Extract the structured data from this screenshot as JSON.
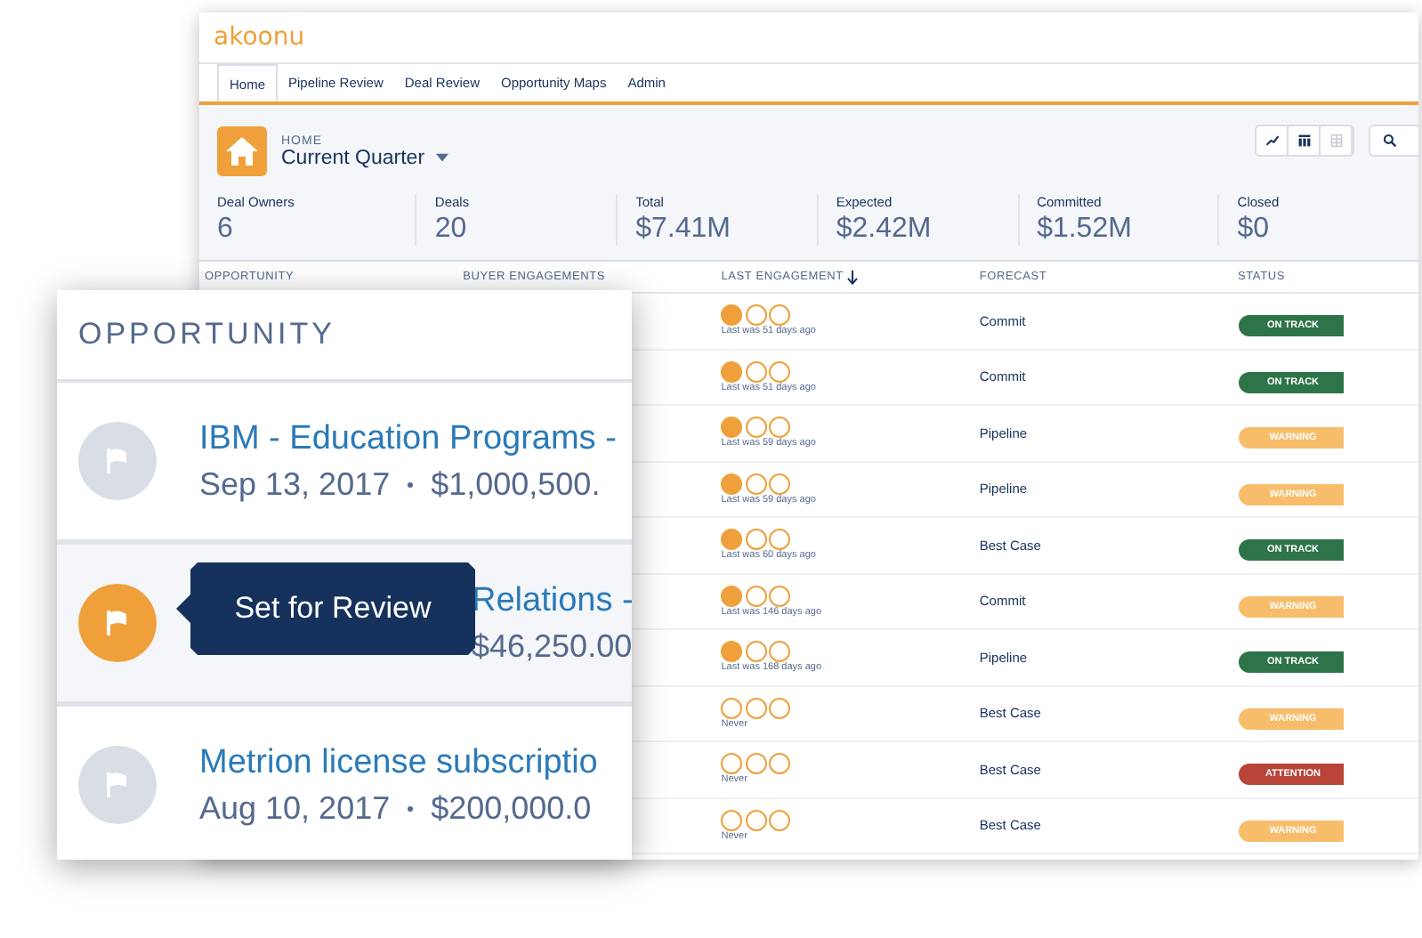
{
  "app": {
    "logo": "akoonu"
  },
  "tabs": [
    {
      "label": "Home",
      "selected": true
    },
    {
      "label": "Pipeline Review",
      "selected": false
    },
    {
      "label": "Deal Review",
      "selected": false
    },
    {
      "label": "Opportunity Maps",
      "selected": false
    },
    {
      "label": "Admin",
      "selected": false
    }
  ],
  "header": {
    "breadcrumb": "HOME",
    "title": "Current Quarter"
  },
  "stats": [
    {
      "label": "Deal Owners",
      "value": "6"
    },
    {
      "label": "Deals",
      "value": "20"
    },
    {
      "label": "Total",
      "value": "$7.41M"
    },
    {
      "label": "Expected",
      "value": "$2.42M"
    },
    {
      "label": "Committed",
      "value": "$1.52M"
    },
    {
      "label": "Closed",
      "value": "$0"
    }
  ],
  "table": {
    "columns": [
      "OPPORTUNITY",
      "BUYER ENGAGEMENTS",
      "LAST ENGAGEMENT",
      "FORECAST",
      "STATUS"
    ],
    "rows": [
      {
        "stars": 1,
        "engagement": "Last was 51 days ago",
        "forecast": "Commit",
        "status": "ON TRACK",
        "color": "#2e7449"
      },
      {
        "stars": 1,
        "engagement": "Last was 51 days ago",
        "forecast": "Commit",
        "status": "ON TRACK",
        "color": "#2e7449"
      },
      {
        "stars": 1,
        "engagement": "Last was 59 days ago",
        "forecast": "Pipeline",
        "status": "WARNING",
        "color": "#f7bd6b"
      },
      {
        "stars": 1,
        "engagement": "Last was 59 days ago",
        "forecast": "Pipeline",
        "status": "WARNING",
        "color": "#f7bd6b"
      },
      {
        "stars": 1,
        "engagement": "Last was 60 days ago",
        "forecast": "Best Case",
        "status": "ON TRACK",
        "color": "#2e7449"
      },
      {
        "stars": 1,
        "engagement": "Last was 146 days ago",
        "forecast": "Commit",
        "status": "WARNING",
        "color": "#f7bd6b"
      },
      {
        "stars": 1,
        "engagement": "Last was 168 days ago",
        "forecast": "Pipeline",
        "status": "ON TRACK",
        "color": "#2e7449"
      },
      {
        "stars": 0,
        "engagement": "Never",
        "forecast": "Best Case",
        "status": "WARNING",
        "color": "#f7bd6b"
      },
      {
        "stars": 0,
        "engagement": "Never",
        "forecast": "Best Case",
        "status": "ATTENTION",
        "color": "#b8443a"
      },
      {
        "stars": 0,
        "engagement": "Never",
        "forecast": "Best Case",
        "status": "WARNING",
        "color": "#f7bd6b"
      }
    ]
  },
  "inset": {
    "heading": "OPPORTUNITY",
    "tooltip": "Set for Review",
    "items": [
      {
        "name": "IBM - Education Programs -",
        "date": "Sep 13, 2017",
        "amount": "$1,000,500.",
        "flagged": false
      },
      {
        "name": "Relations -",
        "amount": "$46,250.00",
        "flagged": true
      },
      {
        "name": "Metrion license subscriptio",
        "date": "Aug 10, 2017",
        "amount": "$200,000.0",
        "flagged": false
      }
    ]
  }
}
